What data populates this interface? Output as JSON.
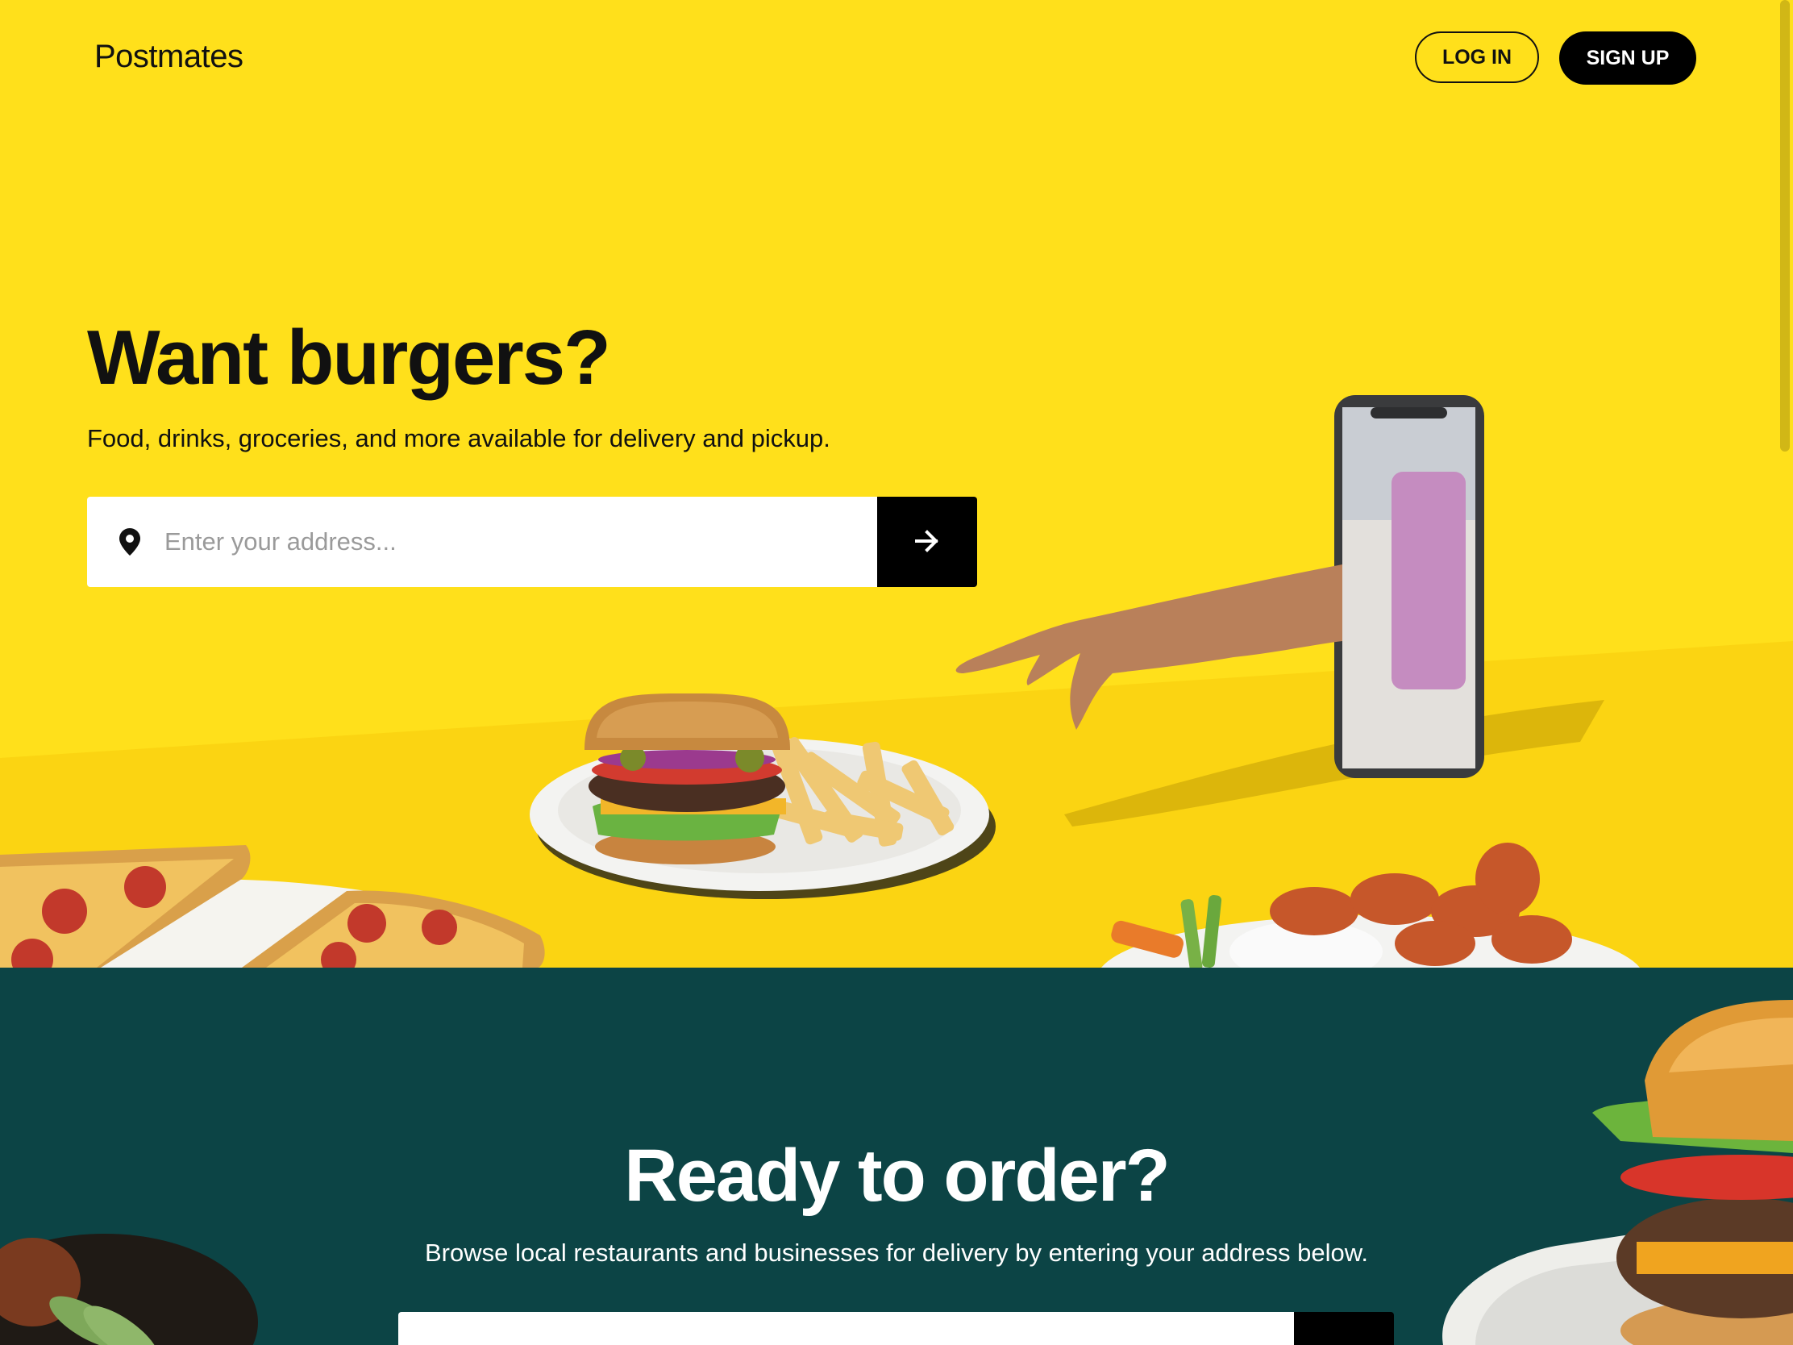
{
  "header": {
    "logo": "Postmates",
    "login_label": "LOG IN",
    "signup_label": "SIGN UP"
  },
  "hero": {
    "title": "Want burgers?",
    "subtitle": "Food, drinks, groceries, and more available for delivery and pickup.",
    "address_placeholder": "Enter your address...",
    "icons": {
      "location": "location-pin-icon",
      "submit": "arrow-right-icon"
    }
  },
  "order_section": {
    "title": "Ready to order?",
    "subtitle": "Browse local restaurants and businesses for delivery by entering your address below."
  },
  "colors": {
    "hero_background": "#ffe01b",
    "order_background": "#0c4445",
    "primary_button": "#000000",
    "text": "#111111"
  }
}
